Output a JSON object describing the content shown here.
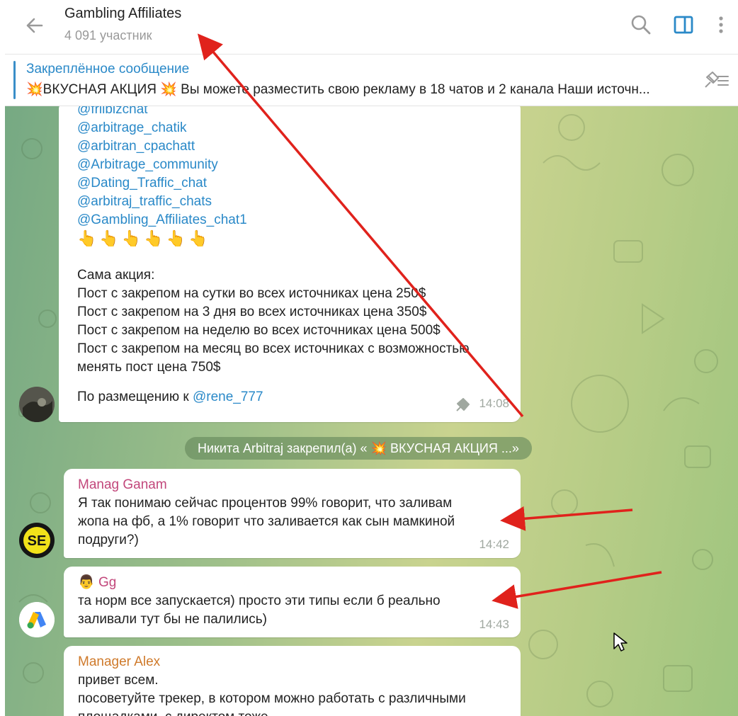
{
  "header": {
    "title": "Gambling Affiliates",
    "subtitle": "4 091 участник"
  },
  "pinned": {
    "title": "Закреплённое сообщение",
    "text": "💥ВКУСНАЯ АКЦИЯ 💥 Вы можете разместить свою рекламу в 18 чатов и 2 канала  Наши источн..."
  },
  "messages": {
    "first": {
      "links": [
        "@frilbizchat",
        "@arbitrage_chatik",
        "@arbitran_cpachatt",
        "@Arbitrage_community",
        "@Dating_Traffic_chat",
        "@arbitraj_traffic_chats",
        "@Gambling_Affiliates_chat1"
      ],
      "pointers": "👆👆👆👆👆👆",
      "promo_header": "Сама акция:",
      "promo_lines": [
        "Пост с закрепом на сутки во всех источниках цена 250$",
        "Пост с закрепом на 3 дня во всех источниках цена 350$",
        "Пост с закрепом на неделю во всех источниках цена 500$",
        "Пост с закрепом на месяц во всех источниках с возможностью",
        "менять пост цена 750$"
      ],
      "contact_prefix": "По размещению к ",
      "contact_link": "@rene_777",
      "time": "14:08"
    },
    "service": "Никита Arbitraj закрепил(а) « 💥 ВКУСНАЯ АКЦИЯ ...»",
    "second": {
      "sender": "Manag Ganam",
      "lines": [
        "Я так понимаю сейчас процентов 99% говорит, что заливам",
        "жопа на фб, а 1% говорит что заливается как сын мамкиной",
        "подруги?)"
      ],
      "time": "14:42",
      "avatar_text": "SE"
    },
    "third": {
      "sender_emoji": "👨",
      "sender": "Gg",
      "lines": [
        "та норм все запускается) просто эти типы если б реально",
        "заливали тут бы не палились)"
      ],
      "time": "14:43"
    },
    "fourth": {
      "sender": "Manager Alex",
      "lines": [
        "привет всем.",
        "посоветуйте трекер, в котором можно работать с различными",
        "площадками, с директом тоже"
      ]
    }
  },
  "colors": {
    "link": "#2a89c8",
    "annotation_arrow": "#e0221c",
    "sender_ganam": "#c2477b",
    "sender_gg": "#c2477b",
    "sender_alex": "#cf7a2b"
  },
  "icons": [
    "back-arrow-icon",
    "search-icon",
    "sidebar-toggle-icon",
    "more-icon",
    "pin-list-icon",
    "pin-icon",
    "annotation-arrow",
    "mouse-cursor-icon"
  ]
}
